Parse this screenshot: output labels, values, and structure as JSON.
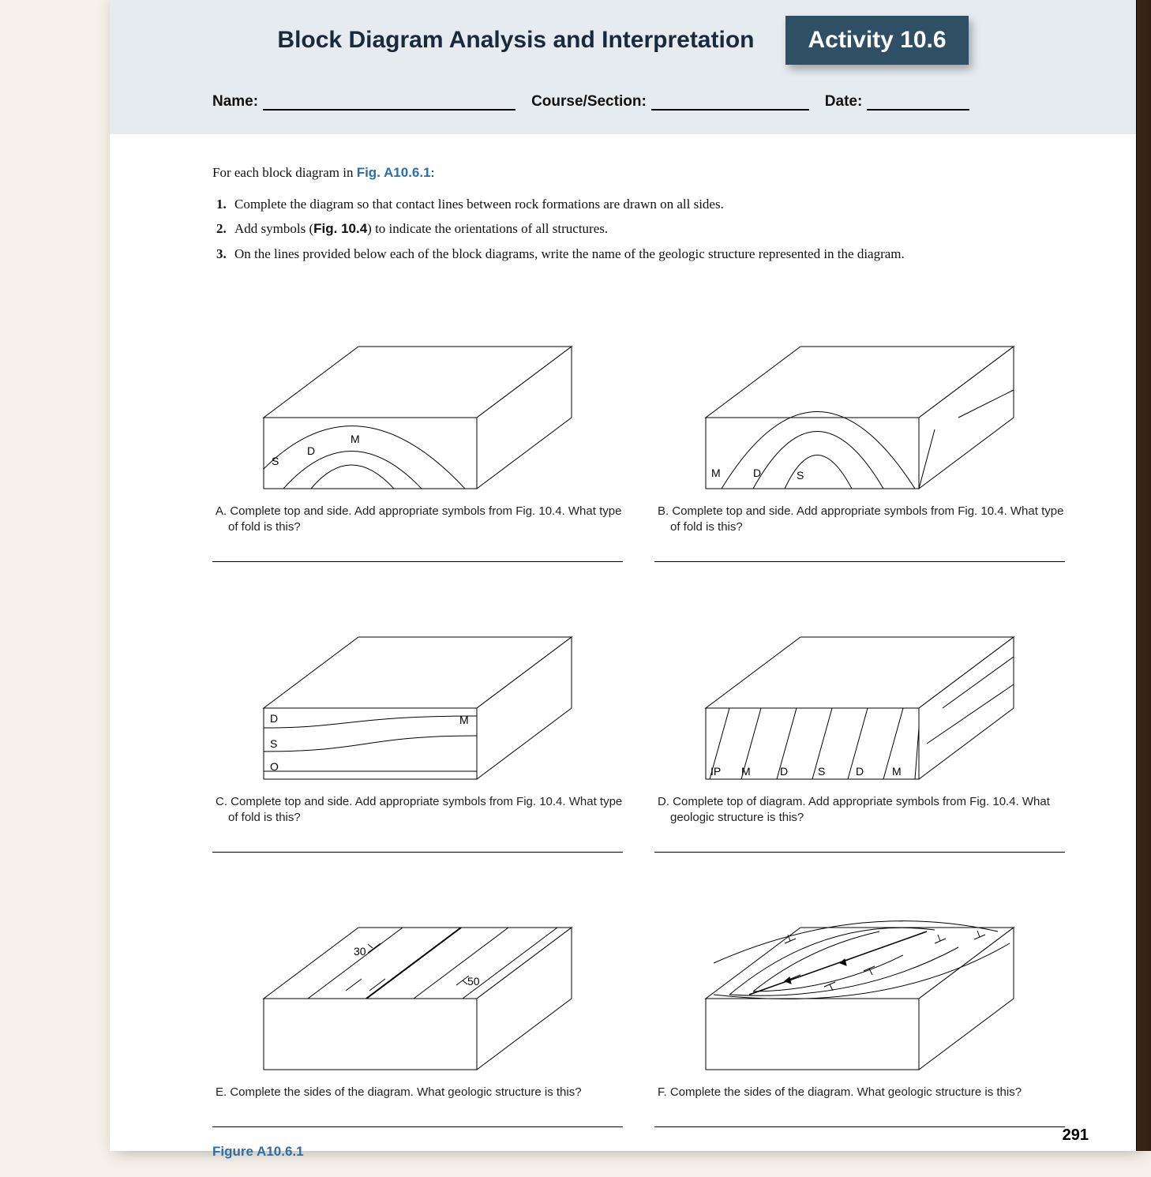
{
  "header": {
    "title": "Block Diagram Analysis and Interpretation",
    "activity_label": "Activity 10.6",
    "name_label": "Name:",
    "course_label": "Course/Section:",
    "date_label": "Date:"
  },
  "intro_prefix": "For each block diagram in ",
  "intro_figref": "Fig. A10.6.1",
  "intro_suffix": ":",
  "instructions": [
    "Complete the diagram so that contact lines between rock formations are drawn on all sides.",
    "Add symbols (Fig. 10.4) to indicate the orientations of all structures.",
    "On the lines provided below each of the block diagrams, write the name of the geologic structure represented in the diagram."
  ],
  "instruction2_prefix": "Add symbols (",
  "instruction2_bold": "Fig. 10.4",
  "instruction2_suffix": ") to indicate the orientations of all structures.",
  "diagrams": {
    "A": {
      "caption": "A. Complete top and side. Add appropriate symbols from Fig. 10.4. What type of fold is this?",
      "labels": [
        "S",
        "D",
        "M"
      ]
    },
    "B": {
      "caption": "B. Complete top and side. Add appropriate symbols from Fig. 10.4. What type of fold is this?",
      "labels": [
        "M",
        "D",
        "S"
      ]
    },
    "C": {
      "caption": "C. Complete top and side. Add appropriate symbols from Fig. 10.4. What type of fold is this?",
      "labels": [
        "D",
        "S",
        "O",
        "M"
      ]
    },
    "D": {
      "caption": "D. Complete top of diagram. Add appropriate symbols from Fig. 10.4. What geologic structure is this?",
      "labels": [
        "IP",
        "M",
        "D",
        "S",
        "D",
        "M"
      ]
    },
    "E": {
      "caption": "E. Complete the sides of the diagram. What geologic structure is this?",
      "labels": [
        "30",
        "50"
      ]
    },
    "F": {
      "caption": "F. Complete the sides of the diagram. What geologic structure is this?"
    }
  },
  "figure_label": "Figure A10.6.1",
  "page_number": "291"
}
